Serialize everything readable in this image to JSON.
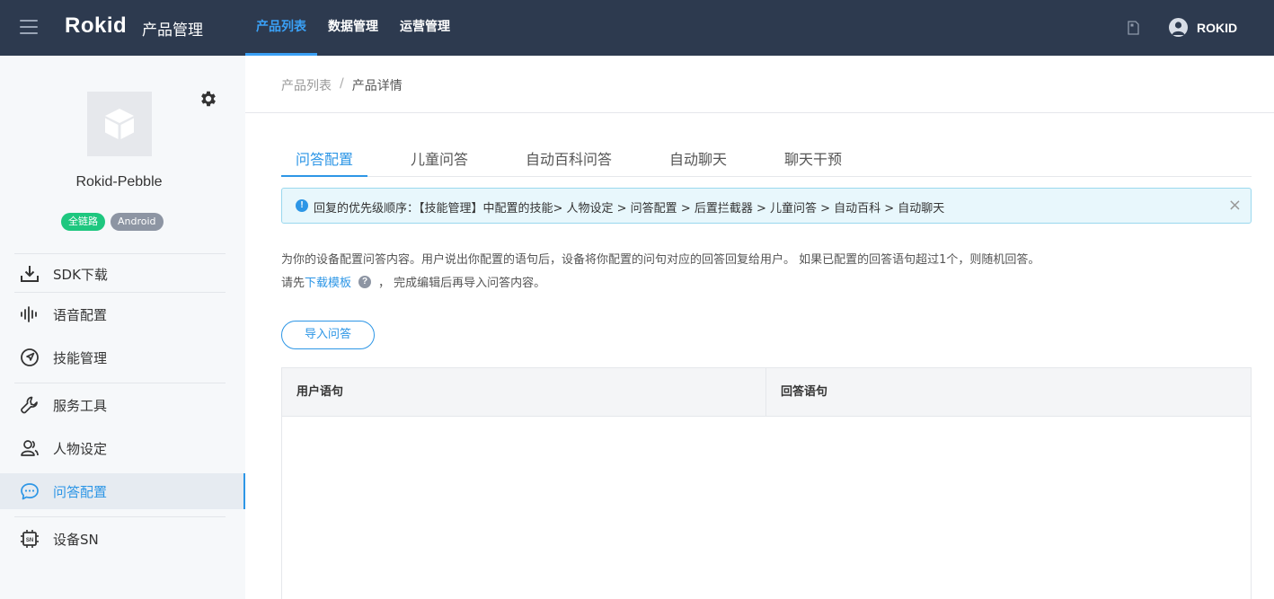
{
  "header": {
    "logo": "Rokid",
    "title": "产品管理",
    "nav": [
      "产品列表",
      "数据管理",
      "运营管理"
    ],
    "active_nav": 0,
    "user_name": "ROKID"
  },
  "sidebar": {
    "product_name": "Rokid-Pebble",
    "tags": [
      "全链路",
      "Android"
    ],
    "menu": [
      {
        "label": "SDK下载",
        "icon": "download-icon"
      },
      {
        "label": "语音配置",
        "icon": "waveform-icon"
      },
      {
        "label": "技能管理",
        "icon": "compass-icon"
      },
      {
        "label": "服务工具",
        "icon": "wrench-icon"
      },
      {
        "label": "人物设定",
        "icon": "people-icon"
      },
      {
        "label": "问答配置",
        "icon": "chat-icon"
      },
      {
        "label": "设备SN",
        "icon": "chip-icon"
      }
    ],
    "active_index": 5
  },
  "breadcrumb": {
    "parent": "产品列表",
    "separator": "/",
    "current": "产品详情"
  },
  "tabs": [
    "问答配置",
    "儿童问答",
    "自动百科问答",
    "自动聊天",
    "聊天干预"
  ],
  "active_tab": 0,
  "alert": {
    "icon": "!",
    "text": "回复的优先级顺序：【技能管理】中配置的技能> 人物设定 > 问答配置 > 后置拦截器 > 儿童问答 > 自动百科 > 自动聊天",
    "close": "×"
  },
  "description": {
    "line1": "为你的设备配置问答内容。用户说出你配置的语句后，设备将你配置的问句对应的回答回复给用户。 如果已配置的回答语句超过1个，则随机回答。",
    "line2_prefix": "请先",
    "line2_link": "下载模板",
    "help": "?",
    "line2_suffix": "，  完成编辑后再导入问答内容。"
  },
  "import_button": "导入问答",
  "table": {
    "columns": [
      "用户语句",
      "回答语句"
    ]
  },
  "colors": {
    "topbar": "#2d3a4f",
    "accent": "#2d96e6",
    "tag_green": "#1ec77f",
    "tag_gray": "#8d95a3"
  }
}
